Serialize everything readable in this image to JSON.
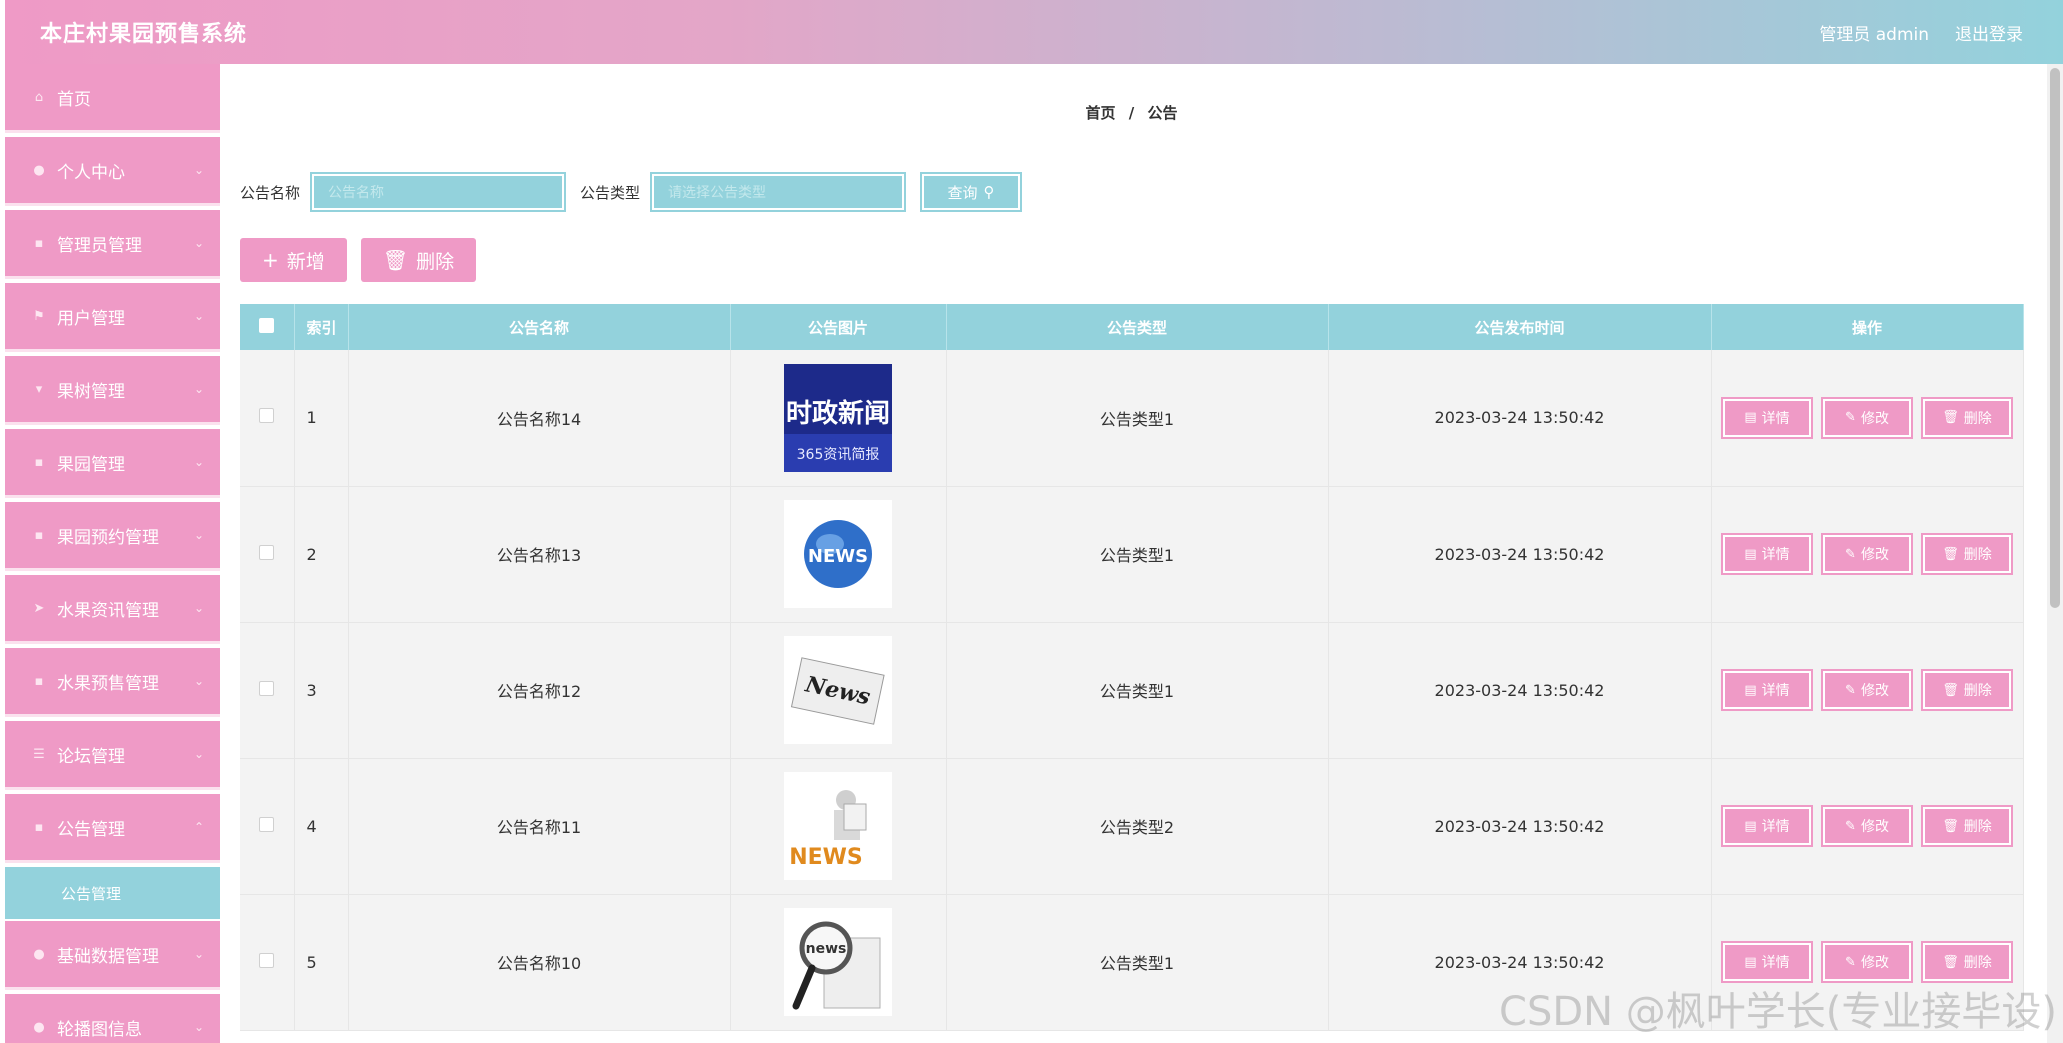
{
  "header": {
    "title": "本庄村果园预售系统",
    "admin": "管理员 admin",
    "logout": "退出登录"
  },
  "sidebar": {
    "items": [
      {
        "label": "首页",
        "icon": "home-icon"
      },
      {
        "label": "个人中心",
        "icon": "user-icon"
      },
      {
        "label": "管理员管理",
        "icon": "grid-icon"
      },
      {
        "label": "用户管理",
        "icon": "flag-icon"
      },
      {
        "label": "果树管理",
        "icon": "tree-icon"
      },
      {
        "label": "果园管理",
        "icon": "grid-icon"
      },
      {
        "label": "果园预约管理",
        "icon": "grid-icon"
      },
      {
        "label": "水果资讯管理",
        "icon": "send-icon"
      },
      {
        "label": "水果预售管理",
        "icon": "grid-icon"
      },
      {
        "label": "论坛管理",
        "icon": "list-icon"
      },
      {
        "label": "公告管理",
        "icon": "grid-icon"
      }
    ],
    "active_sub": "公告管理",
    "bottom_items": [
      {
        "label": "基础数据管理",
        "icon": "user-icon"
      },
      {
        "label": "轮播图信息",
        "icon": "user-icon"
      }
    ]
  },
  "breadcrumb": {
    "home": "首页",
    "sep": "/",
    "current": "公告"
  },
  "search": {
    "name_label": "公告名称",
    "name_placeholder": "公告名称",
    "type_label": "公告类型",
    "type_placeholder": "请选择公告类型",
    "button": "查询"
  },
  "actions": {
    "add": "新增",
    "delete": "删除"
  },
  "table": {
    "headers": [
      "索引",
      "公告名称",
      "公告图片",
      "公告类型",
      "公告发布时间",
      "操作"
    ],
    "rows": [
      {
        "index": "1",
        "name": "公告名称14",
        "type": "公告类型1",
        "time": "2023-03-24 13:50:42",
        "image": "时政新闻 365资讯简报"
      },
      {
        "index": "2",
        "name": "公告名称13",
        "type": "公告类型1",
        "time": "2023-03-24 13:50:42",
        "image": "NEWS"
      },
      {
        "index": "3",
        "name": "公告名称12",
        "type": "公告类型1",
        "time": "2023-03-24 13:50:42",
        "image": "News"
      },
      {
        "index": "4",
        "name": "公告名称11",
        "type": "公告类型2",
        "time": "2023-03-24 13:50:42",
        "image": "NEWS"
      },
      {
        "index": "5",
        "name": "公告名称10",
        "type": "公告类型1",
        "time": "2023-03-24 13:50:42",
        "image": "news"
      }
    ],
    "ops": {
      "detail": "详情",
      "edit": "修改",
      "delete": "删除"
    }
  },
  "watermark": "CSDN @枫叶学长(专业接毕设)"
}
